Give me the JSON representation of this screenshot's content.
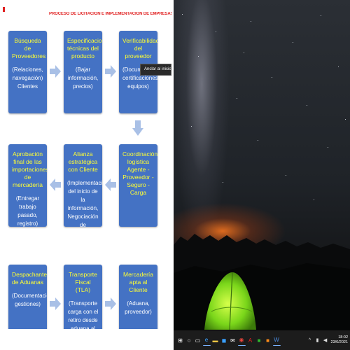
{
  "document": {
    "title": "PROCESO DE LICITACIÓN E IMPLEMENTACIÓN DE EMPRESAS CTAS",
    "cards": [
      {
        "title": "Búsqueda de Proveedores",
        "body": "(Relaciones, navegación) Clientes"
      },
      {
        "title": "Especificaciones técnicas del producto",
        "body": "(Bajar información, precios)"
      },
      {
        "title": "Verificabilidad del proveedor",
        "body": "(Documentos, certificaciones, equipos)"
      },
      {
        "title": "Aprobación final de las importaciones de mercadería",
        "body": "(Entregar trabajo pasado, registro)"
      },
      {
        "title": "Alianza estratégica con Cliente",
        "body": "(Implementación del inicio de la información, Negociación de inspección inicial)"
      },
      {
        "title": "Coordinación logística Agente - Proveedor - Seguro - Carga",
        "body": ""
      },
      {
        "title": "Despachante de Aduanas",
        "body": "(Documentaciones, gestiones)"
      },
      {
        "title": "Transporte Fiscal (TLA)",
        "body": "(Transporte carga con el retiro desde aduana al proveedor)"
      },
      {
        "title": "Mercadería apta al Cliente",
        "body": "(Aduana, proveedor)"
      }
    ]
  },
  "tooltip": {
    "text": "Anclar al inicio"
  },
  "taskbar": {
    "icons": [
      {
        "name": "start-icon",
        "glyph": "⊞",
        "color": "#ffffff",
        "active": false
      },
      {
        "name": "search-icon",
        "glyph": "○",
        "color": "#ffffff",
        "active": false
      },
      {
        "name": "task-view-icon",
        "glyph": "▭",
        "color": "#ffffff",
        "active": false
      },
      {
        "name": "edge-icon",
        "glyph": "e",
        "color": "#3aa0ff",
        "active": true
      },
      {
        "name": "file-explorer-icon",
        "glyph": "▬",
        "color": "#f2c744",
        "active": false
      },
      {
        "name": "store-icon",
        "glyph": "◼",
        "color": "#3aa0ff",
        "active": false
      },
      {
        "name": "mail-icon",
        "glyph": "✉",
        "color": "#ffffff",
        "active": false
      },
      {
        "name": "chrome-icon",
        "glyph": "◉",
        "color": "#e8453c",
        "active": true
      },
      {
        "name": "acrobat-icon",
        "glyph": "A",
        "color": "#e02020",
        "active": false
      },
      {
        "name": "app-green-icon",
        "glyph": "■",
        "color": "#2eb82e",
        "active": false
      },
      {
        "name": "app-orange-icon",
        "glyph": "■",
        "color": "#ff8c1a",
        "active": false
      },
      {
        "name": "word-icon",
        "glyph": "W",
        "color": "#4a89dc",
        "active": true
      }
    ],
    "tray": [
      {
        "name": "chevron-up-icon",
        "glyph": "^"
      },
      {
        "name": "network-icon",
        "glyph": "▮"
      },
      {
        "name": "volume-icon",
        "glyph": "◀"
      }
    ],
    "clock_time": "18:02",
    "clock_date": "23/6/2021"
  },
  "colors": {
    "card_fill": "#4472c4",
    "card_title": "#ffff33",
    "card_text": "#ffffff",
    "doc_title": "#e02020",
    "arrow": "#a9c0e6"
  }
}
